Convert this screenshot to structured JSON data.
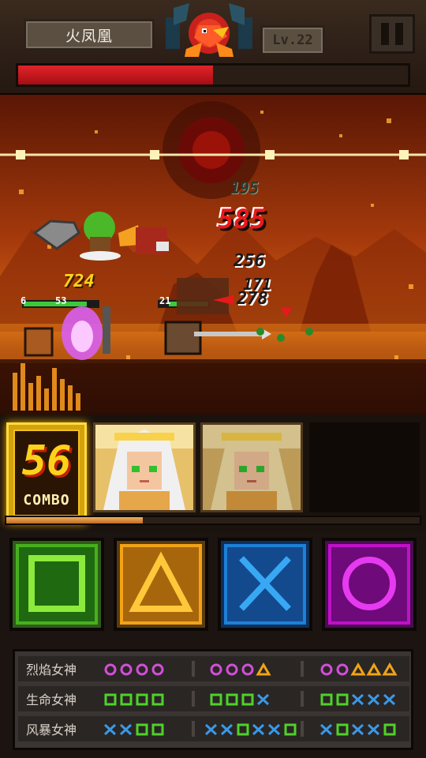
{
  "header": {
    "boss_name": "火凤凰",
    "level": "Lv.22",
    "boss_hp_fraction": 0.5,
    "pause_icon": "pause-icon"
  },
  "battle": {
    "damage_numbers": [
      "195",
      "585",
      "256",
      "171",
      "278"
    ],
    "player_damage": "724",
    "ally_hp_values": [
      "6",
      "53"
    ],
    "enemy_hp_value": "21"
  },
  "combo": {
    "count": "56",
    "label": "COMBO",
    "charge_fraction": 0.33
  },
  "buttons": [
    {
      "name": "square-button",
      "icon": "square-icon",
      "color": "#3aa51e"
    },
    {
      "name": "triangle-button",
      "icon": "triangle-icon",
      "color": "#f2a316"
    },
    {
      "name": "cross-button",
      "icon": "cross-icon",
      "color": "#1e80d8"
    },
    {
      "name": "circle-button",
      "icon": "circle-icon",
      "color": "#c010c8"
    }
  ],
  "skills": [
    {
      "name": "烈焰女神",
      "color": "#d24ed8",
      "sequences": [
        [
          "O",
          "O",
          "O",
          "O"
        ],
        [
          "O",
          "O",
          "O",
          "△"
        ],
        [
          "O",
          "O",
          "△",
          "△",
          "△"
        ]
      ]
    },
    {
      "name": "生命女神",
      "color": "#4fd12a",
      "sequences": [
        [
          "□",
          "□",
          "□",
          "□"
        ],
        [
          "□",
          "□",
          "□",
          "X"
        ],
        [
          "□",
          "□",
          "X",
          "X",
          "X"
        ]
      ]
    },
    {
      "name": "风暴女神",
      "color": "#3a98e8",
      "sequences": [
        [
          "X",
          "X",
          "□",
          "□"
        ],
        [
          "X",
          "X",
          "□",
          "X",
          "X",
          "□"
        ],
        [
          "X",
          "□",
          "X",
          "X",
          "□"
        ]
      ]
    }
  ]
}
